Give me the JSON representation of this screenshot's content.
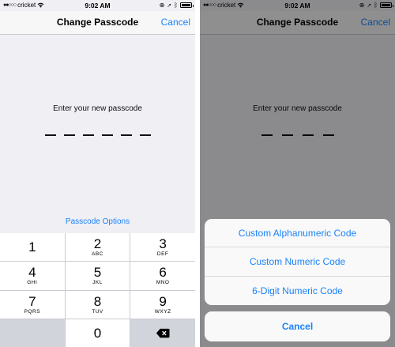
{
  "status_bar": {
    "carrier": "cricket",
    "time": "9:02 AM"
  },
  "nav": {
    "title": "Change Passcode",
    "cancel_label": "Cancel"
  },
  "passcode": {
    "prompt": "Enter your new passcode",
    "options_link": "Passcode Options"
  },
  "keypad": {
    "keys": [
      {
        "digit": "1",
        "letters": ""
      },
      {
        "digit": "2",
        "letters": "ABC"
      },
      {
        "digit": "3",
        "letters": "DEF"
      },
      {
        "digit": "4",
        "letters": "GHI"
      },
      {
        "digit": "5",
        "letters": "JKL"
      },
      {
        "digit": "6",
        "letters": "MNO"
      },
      {
        "digit": "7",
        "letters": "PQRS"
      },
      {
        "digit": "8",
        "letters": "TUV"
      },
      {
        "digit": "9",
        "letters": "WXYZ"
      },
      {
        "digit": "0",
        "letters": ""
      }
    ],
    "delete_icon": "backspace-icon"
  },
  "action_sheet": {
    "options": [
      "Custom Alphanumeric Code",
      "Custom Numeric Code",
      "6-Digit Numeric Code"
    ],
    "cancel_label": "Cancel"
  },
  "colors": {
    "accent": "#1a82fb",
    "background": "#efeff4",
    "overlay": "rgba(0,0,0,0.42)"
  }
}
